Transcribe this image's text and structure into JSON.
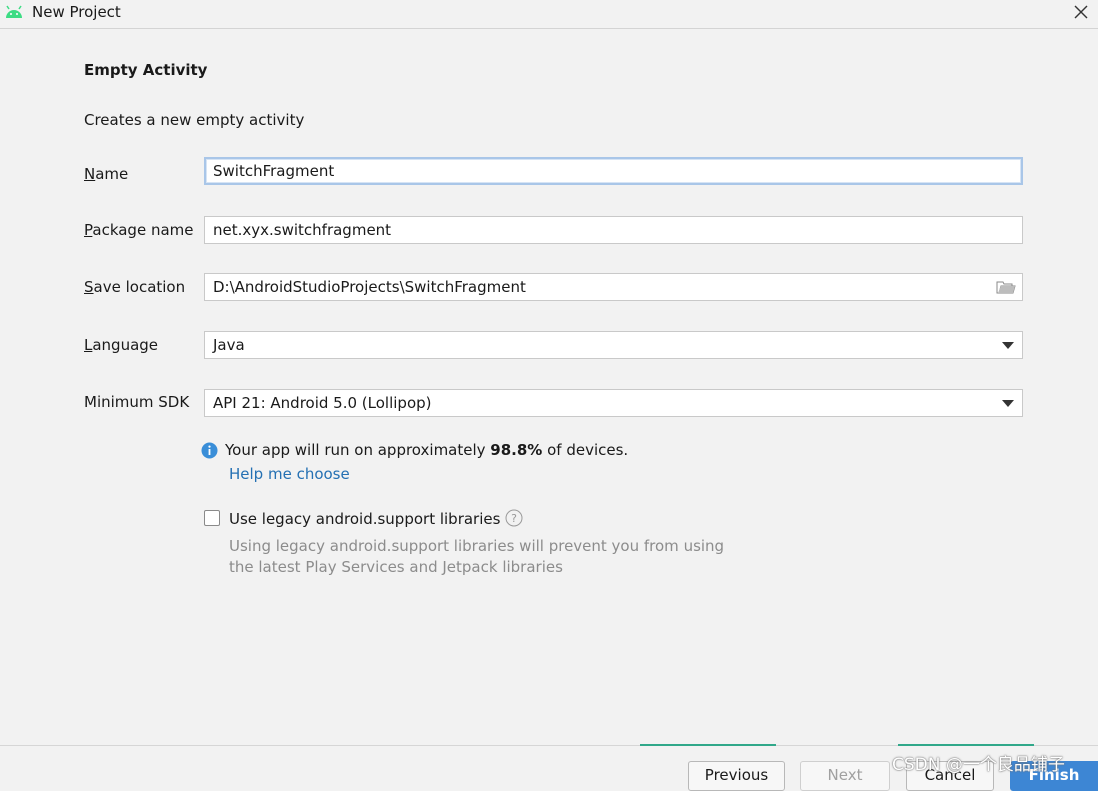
{
  "window": {
    "title": "New Project",
    "icon": "android-icon"
  },
  "page": {
    "heading": "Empty Activity",
    "description": "Creates a new empty activity"
  },
  "form": {
    "name": {
      "label_mn": "N",
      "label_rest": "ame",
      "value": "SwitchFragment"
    },
    "package": {
      "label_mn": "P",
      "label_rest": "ackage name",
      "value": "net.xyx.switchfragment"
    },
    "save_location": {
      "label_mn": "S",
      "label_rest": "ave location",
      "value": "D:\\AndroidStudioProjects\\SwitchFragment",
      "icon": "folder-icon"
    },
    "language": {
      "label_mn": "L",
      "label_rest": "anguage",
      "value": "Java"
    },
    "min_sdk": {
      "label": "Minimum SDK",
      "value": "API 21: Android 5.0 (Lollipop)"
    }
  },
  "info": {
    "prefix": "Your app will run on approximately ",
    "percent": "98.8%",
    "suffix": " of devices.",
    "help_link": "Help me choose"
  },
  "legacy": {
    "checked": false,
    "label": "Use legacy android.support libraries",
    "hint_line1": "Using legacy android.support libraries will prevent you from using",
    "hint_line2": "the latest Play Services and Jetpack libraries"
  },
  "buttons": {
    "previous": "Previous",
    "next": "Next",
    "cancel": "Cancel",
    "finish": "Finish"
  },
  "watermark": "CSDN @一个良品铺子",
  "colors": {
    "accent": "#3d86d4",
    "link": "#2470b3",
    "android_green": "#3ddc84",
    "info_blue": "#3a8ed8"
  }
}
